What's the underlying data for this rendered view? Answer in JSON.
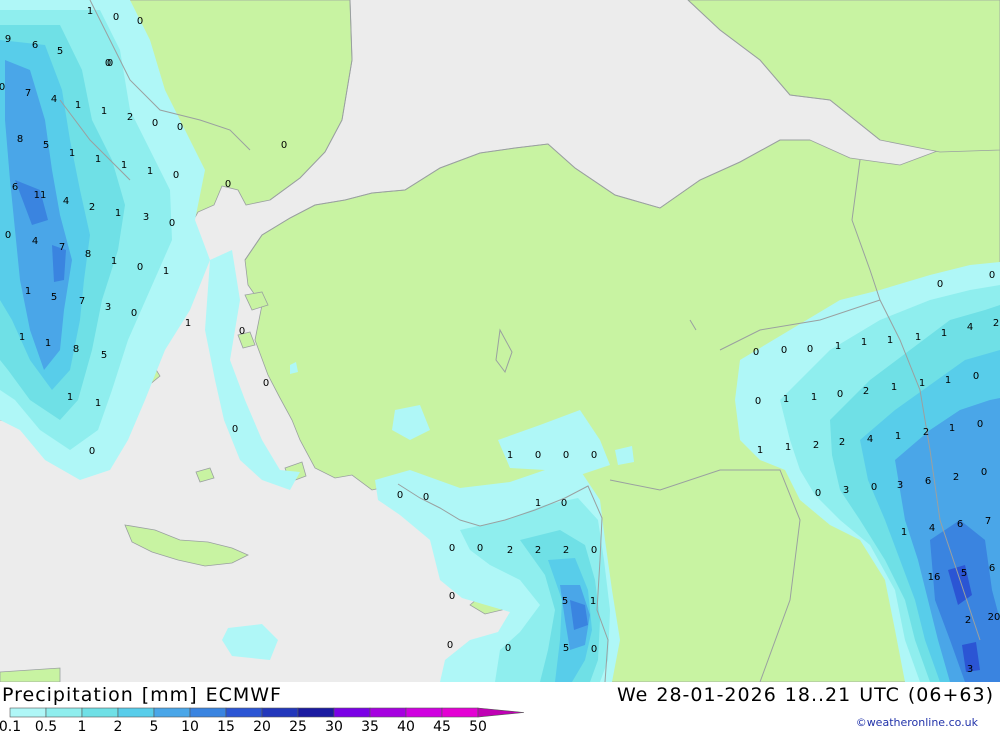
{
  "colors": {
    "sea": "#ececec",
    "land": "#c8f3a2",
    "border": "#9aa0a0",
    "p01": "#aff7f7",
    "p05": "#8feeee",
    "p1": "#6fe0e6",
    "p2": "#58cdea",
    "p5": "#4aa6e8",
    "p10": "#3a84e0",
    "p15": "#2b55d4",
    "p20": "#2237bb"
  },
  "title": {
    "label": "Precipitation",
    "unit": "[mm]",
    "model": "ECMWF"
  },
  "valid_time": {
    "day": "We",
    "date": "28-01-2026",
    "hours": "18..21",
    "tz": "UTC",
    "lead": "(06+63)"
  },
  "legend": {
    "items": [
      {
        "label": "0.1",
        "color": "#aff7f7"
      },
      {
        "label": "0.5",
        "color": "#8feeee"
      },
      {
        "label": "1",
        "color": "#6fe0e6"
      },
      {
        "label": "2",
        "color": "#58cdea"
      },
      {
        "label": "5",
        "color": "#4aa6e8"
      },
      {
        "label": "10",
        "color": "#3a84e0"
      },
      {
        "label": "15",
        "color": "#2b55d4"
      },
      {
        "label": "20",
        "color": "#2237bb"
      },
      {
        "label": "25",
        "color": "#1a1aa0"
      },
      {
        "label": "30",
        "color": "#7a00e6"
      },
      {
        "label": "35",
        "color": "#a600e0"
      },
      {
        "label": "40",
        "color": "#d000e0"
      },
      {
        "label": "45",
        "color": "#e400d4"
      },
      {
        "label": "50",
        "color": "#c000b4"
      }
    ]
  },
  "credit": "©weatheronline.co.uk",
  "values": {
    "west": [
      "1",
      "0",
      "0",
      "9",
      "6",
      "5",
      "0",
      "0",
      "7",
      "4",
      "1",
      "1",
      "2",
      "0",
      "0",
      "8",
      "5",
      "1",
      "1",
      "1",
      "1",
      "0",
      "0",
      "6",
      "11",
      "4",
      "2",
      "1",
      "3",
      "0",
      "0",
      "4",
      "7",
      "8",
      "1",
      "0",
      "1",
      "1",
      "5",
      "7",
      "3",
      "0",
      "1",
      "1",
      "8",
      "5",
      "1",
      "1",
      "1",
      "0",
      "0",
      "0",
      "0",
      "0",
      "0"
    ],
    "center": [
      "1",
      "0",
      "0",
      "0",
      "0",
      "0",
      "1",
      "0",
      "0",
      "0",
      "2",
      "2",
      "2",
      "0",
      "0",
      "5",
      "1",
      "0",
      "0",
      "5",
      "0"
    ],
    "east": [
      "0",
      "0",
      "0",
      "0",
      "0",
      "1",
      "1",
      "1",
      "1",
      "1",
      "4",
      "2",
      "0",
      "1",
      "1",
      "0",
      "2",
      "1",
      "1",
      "1",
      "0",
      "1",
      "1",
      "2",
      "2",
      "4",
      "1",
      "2",
      "1",
      "0",
      "0",
      "3",
      "0",
      "3",
      "6",
      "2",
      "0",
      "1",
      "4",
      "6",
      "7",
      "16",
      "5",
      "6",
      "2",
      "20",
      "3"
    ]
  }
}
